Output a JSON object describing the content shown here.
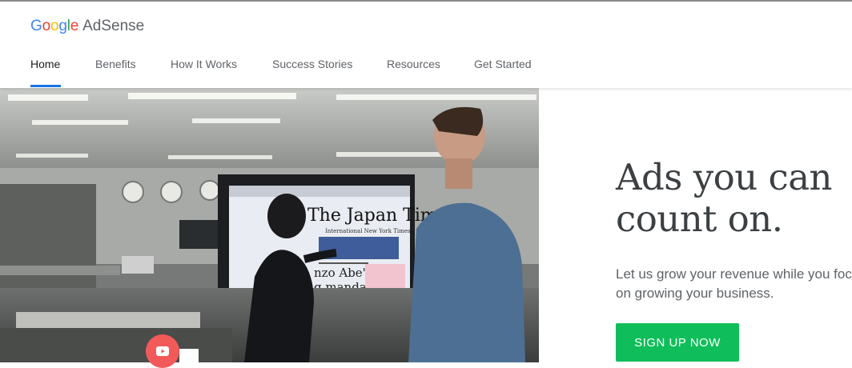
{
  "brand": {
    "google_letters": [
      {
        "ch": "G",
        "color": "#4285F4"
      },
      {
        "ch": "o",
        "color": "#EA4335"
      },
      {
        "ch": "o",
        "color": "#FBBC05"
      },
      {
        "ch": "g",
        "color": "#4285F4"
      },
      {
        "ch": "l",
        "color": "#34A853"
      },
      {
        "ch": "e",
        "color": "#EA4335"
      }
    ],
    "product": "AdSense"
  },
  "nav": {
    "items": [
      {
        "label": "Home",
        "active": true
      },
      {
        "label": "Benefits",
        "active": false
      },
      {
        "label": "How It Works",
        "active": false
      },
      {
        "label": "Success Stories",
        "active": false
      },
      {
        "label": "Resources",
        "active": false
      },
      {
        "label": "Get Started",
        "active": false
      }
    ],
    "accent": "#1a73e8"
  },
  "hero": {
    "video_thumbnail": {
      "screen_masthead": "The Japan Times",
      "screen_subhead": "International New York Times",
      "screen_headline_line1": "nzo Abe's",
      "screen_headline_line2": "g mandate"
    },
    "play_icon": "youtube-play-icon",
    "headline": "Ads you can count on.",
    "subtext": "Let us grow your revenue while you focus on growing your business.",
    "cta_label": "SIGN UP NOW",
    "cta_color": "#0fbe5a"
  }
}
